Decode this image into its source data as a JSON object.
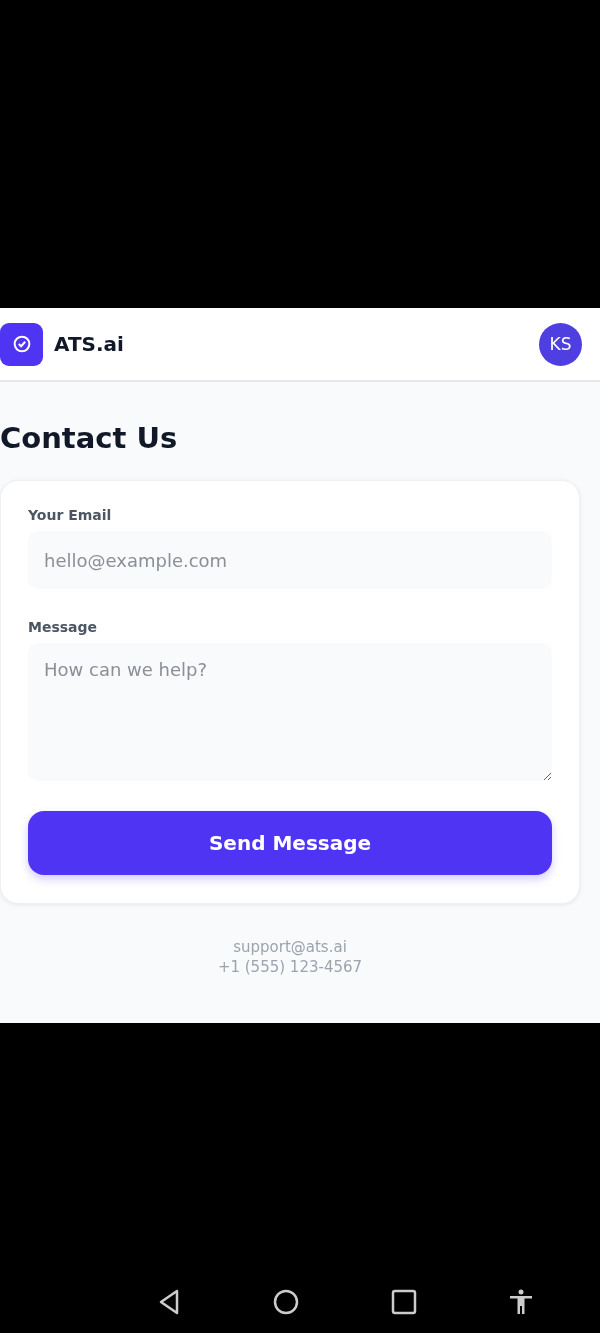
{
  "header": {
    "brand": "ATS.ai",
    "avatar": "KS"
  },
  "title": "Contact Us",
  "form": {
    "fields": [
      {
        "kind": "input",
        "label": "Your Email",
        "placeholder": "hello@example.com"
      },
      {
        "kind": "textarea",
        "label": "Message",
        "placeholder": "How can we help?"
      }
    ],
    "submit": "Send Message"
  },
  "footer": [
    "support@ats.ai",
    "+1 (555) 123-4567"
  ]
}
